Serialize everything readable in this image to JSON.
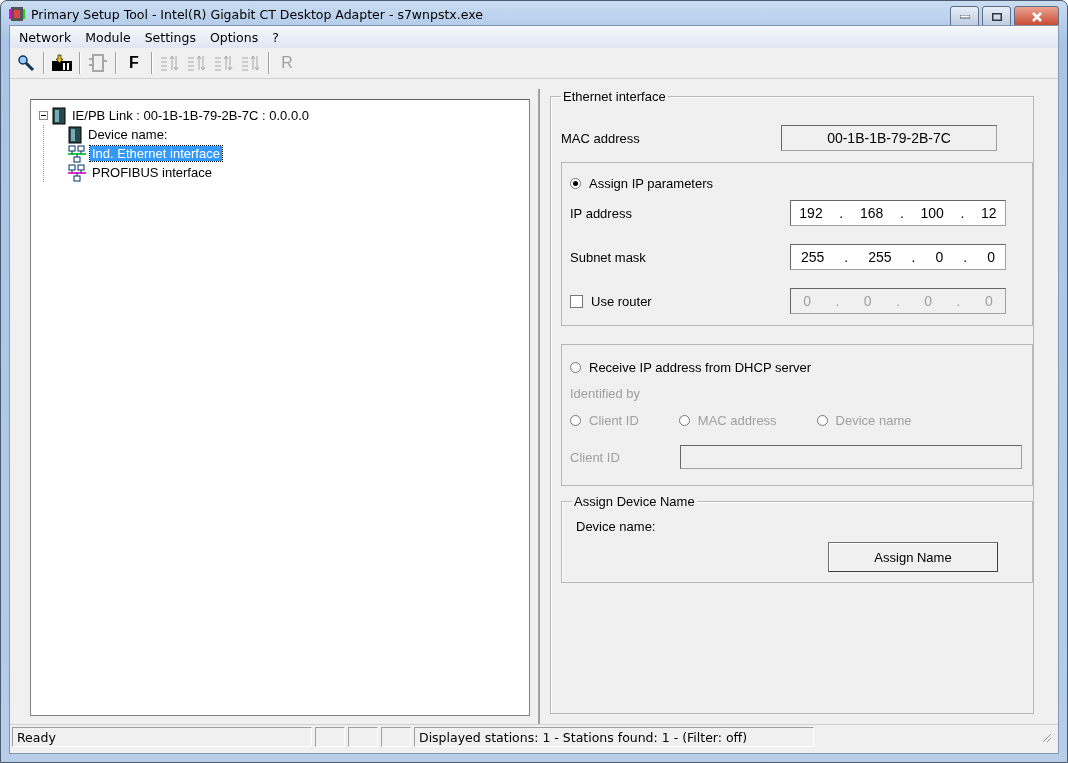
{
  "window": {
    "title": "Primary Setup Tool - Intel(R) Gigabit CT Desktop Adapter - s7wnpstx.exe"
  },
  "menu": [
    "Network",
    "Module",
    "Settings",
    "Options",
    "?"
  ],
  "toolbar": [
    {
      "kind": "search",
      "disabled": false
    },
    {
      "kind": "separator"
    },
    {
      "kind": "download",
      "disabled": false
    },
    {
      "kind": "separator"
    },
    {
      "kind": "module",
      "disabled": true
    },
    {
      "kind": "separator"
    },
    {
      "kind": "letter",
      "label": "F",
      "disabled": false
    },
    {
      "kind": "separator"
    },
    {
      "kind": "sort",
      "disabled": true
    },
    {
      "kind": "sort",
      "disabled": true
    },
    {
      "kind": "sort",
      "disabled": true
    },
    {
      "kind": "sort",
      "disabled": true
    },
    {
      "kind": "separator"
    },
    {
      "kind": "letter",
      "label": "R",
      "disabled": true
    }
  ],
  "tree": {
    "label": "IE/PB Link : 00-1B-1B-79-2B-7C : 0.0.0.0",
    "kind": "device",
    "expanded": true,
    "selected": false,
    "children": [
      {
        "label": "Device name:",
        "kind": "device",
        "selected": false
      },
      {
        "label": "Ind. Ethernet interface",
        "kind": "ethernet",
        "selected": true
      },
      {
        "label": "PROFIBUS interface",
        "kind": "profibus",
        "selected": false
      }
    ]
  },
  "ethernet_group": {
    "title": "Ethernet interface",
    "mac_label": "MAC address",
    "mac_value": "00-1B-1B-79-2B-7C"
  },
  "assign_ip": {
    "label": "Assign IP parameters",
    "selected": true,
    "ip_label": "IP address",
    "ip_octets": [
      "192",
      ".",
      "168",
      ".",
      "100",
      ".",
      "12"
    ],
    "subnet_label": "Subnet mask",
    "subnet_octets": [
      "255",
      ".",
      "255",
      ".",
      "0",
      ".",
      "0"
    ],
    "use_router": {
      "label": "Use router",
      "checked": false
    },
    "router_octets": [
      "0",
      ".",
      "0",
      ".",
      "0",
      ".",
      "0"
    ],
    "router_disabled": true
  },
  "dhcp": {
    "label": "Receive IP address from DHCP server",
    "selected": false,
    "disabled": true,
    "identified_by": "Identified by",
    "options": [
      {
        "label": "Client ID",
        "selected": false
      },
      {
        "label": "MAC address",
        "selected": false
      },
      {
        "label": "Device name",
        "selected": false
      }
    ],
    "client_id_label": "Client ID"
  },
  "device_name_group": {
    "title": "Assign Device Name",
    "label": "Device name:",
    "button": "Assign Name"
  },
  "status_bar": {
    "ready": "Ready",
    "stations": "Displayed stations: 1 - Stations found: 1 - (Filter: off)"
  }
}
